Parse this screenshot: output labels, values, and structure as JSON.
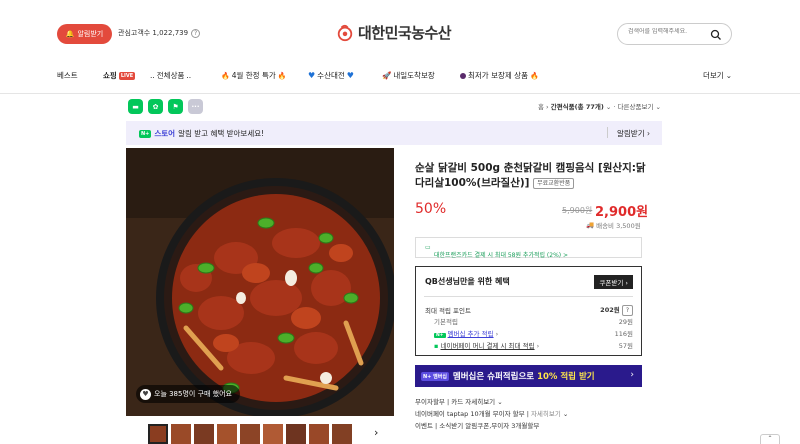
{
  "header": {
    "notify_label": "알림받기",
    "fav_label": "관심고객수 1,022,739",
    "store_name": "대한민국농수산",
    "search_placeholder": "검색어를 입력해주세요."
  },
  "nav": {
    "best": "베스트",
    "shopping": "쇼핑",
    "live": "LIVE",
    "all_products": "전체상품",
    "limited": "4월 한정 특가",
    "seafood": "수산대전",
    "tomorrow": "내일도착보장",
    "lowest": "최저가 보장제 상품",
    "more": "더보기"
  },
  "breadcrumb": {
    "home": "홈",
    "category": "간편식품(총 77개)",
    "other": "다른상품보기"
  },
  "store_banner": {
    "store_tag": "N+",
    "store_word": "스토어",
    "text": "알림 받고 혜택 받아보세요!",
    "alarm": "알림받기"
  },
  "photo": {
    "bought_text": "오늘 385명이 구매 했어요"
  },
  "product": {
    "title": "순살 닭갈비 500g 춘천닭갈비 캠핑음식 [원산지:닭다리살100%(브라질산)]",
    "badge": "무료교환반품",
    "discount": "50%",
    "original_price": "5,900원",
    "price": "2,900원",
    "shipping": "배송비 3,500원",
    "card_promo": "대한프랜즈카드 결제 시 최대 58원 추가적립 (2%) >"
  },
  "benefit": {
    "title": "QB선생님만을 위한 혜택",
    "coupon_btn": "쿠폰받기",
    "max_point_label": "최대 적립 포인트",
    "max_point_value": "202원",
    "base_label": "기본적립",
    "base_value": "29원",
    "member_label": "멤버십 추가 적립",
    "member_value": "116원",
    "npay_label": "네이버페이 머니 결제 시 최대 적립",
    "npay_value": "57원"
  },
  "membership": {
    "tag": "N+ 멤버십",
    "text_pre": "멤버십은 슈퍼적립으로",
    "text_em": "10% 적립 받기"
  },
  "info_lines": {
    "installment": "무이자할부",
    "installment_detail": "카드 자세히보기",
    "taptap": "네이버페이 taptap 10개월 무이자 할부",
    "taptap_detail": "자세히보기",
    "event_label": "이벤트",
    "event_text": "소식받기 알림쿠폰,무이자 3개월할부"
  },
  "colors": {
    "accent_red": "#e02b2b",
    "notify_red": "#e34a3c",
    "membership_bg": "#2a1a8c",
    "naver_green": "#03c75a"
  }
}
